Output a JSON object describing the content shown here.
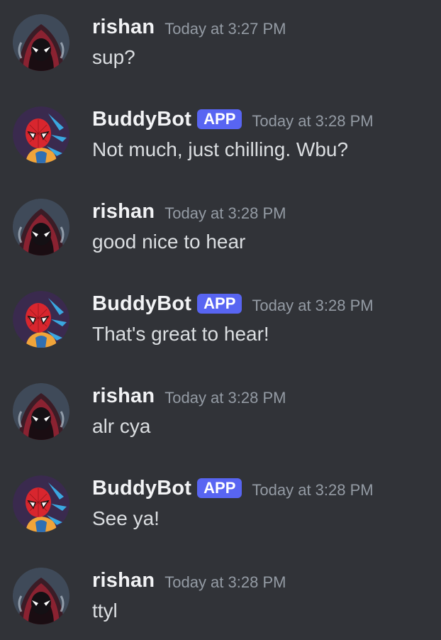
{
  "messages": [
    {
      "author": "rishan",
      "bot": false,
      "badge": "",
      "time": "Today at 3:27 PM",
      "text": "sup?"
    },
    {
      "author": "BuddyBot",
      "bot": true,
      "badge": "APP",
      "time": "Today at 3:28 PM",
      "text": "Not much, just chilling. Wbu?"
    },
    {
      "author": "rishan",
      "bot": false,
      "badge": "",
      "time": "Today at 3:28 PM",
      "text": "good nice to hear"
    },
    {
      "author": "BuddyBot",
      "bot": true,
      "badge": "APP",
      "time": "Today at 3:28 PM",
      "text": "That's great to hear!"
    },
    {
      "author": "rishan",
      "bot": false,
      "badge": "",
      "time": "Today at 3:28 PM",
      "text": "alr cya"
    },
    {
      "author": "BuddyBot",
      "bot": true,
      "badge": "APP",
      "time": "Today at 3:28 PM",
      "text": "See ya!"
    },
    {
      "author": "rishan",
      "bot": false,
      "badge": "",
      "time": "Today at 3:28 PM",
      "text": "ttyl"
    }
  ],
  "icons": {
    "user_avatar": "miles-morales-spiderman-avatar-icon",
    "bot_avatar": "spiderman-avatar-icon"
  },
  "colors": {
    "background": "#313338",
    "author": "#f2f3f5",
    "timestamp": "#949ba4",
    "message_text": "#dbdee1",
    "app_badge": "#5865f2"
  }
}
